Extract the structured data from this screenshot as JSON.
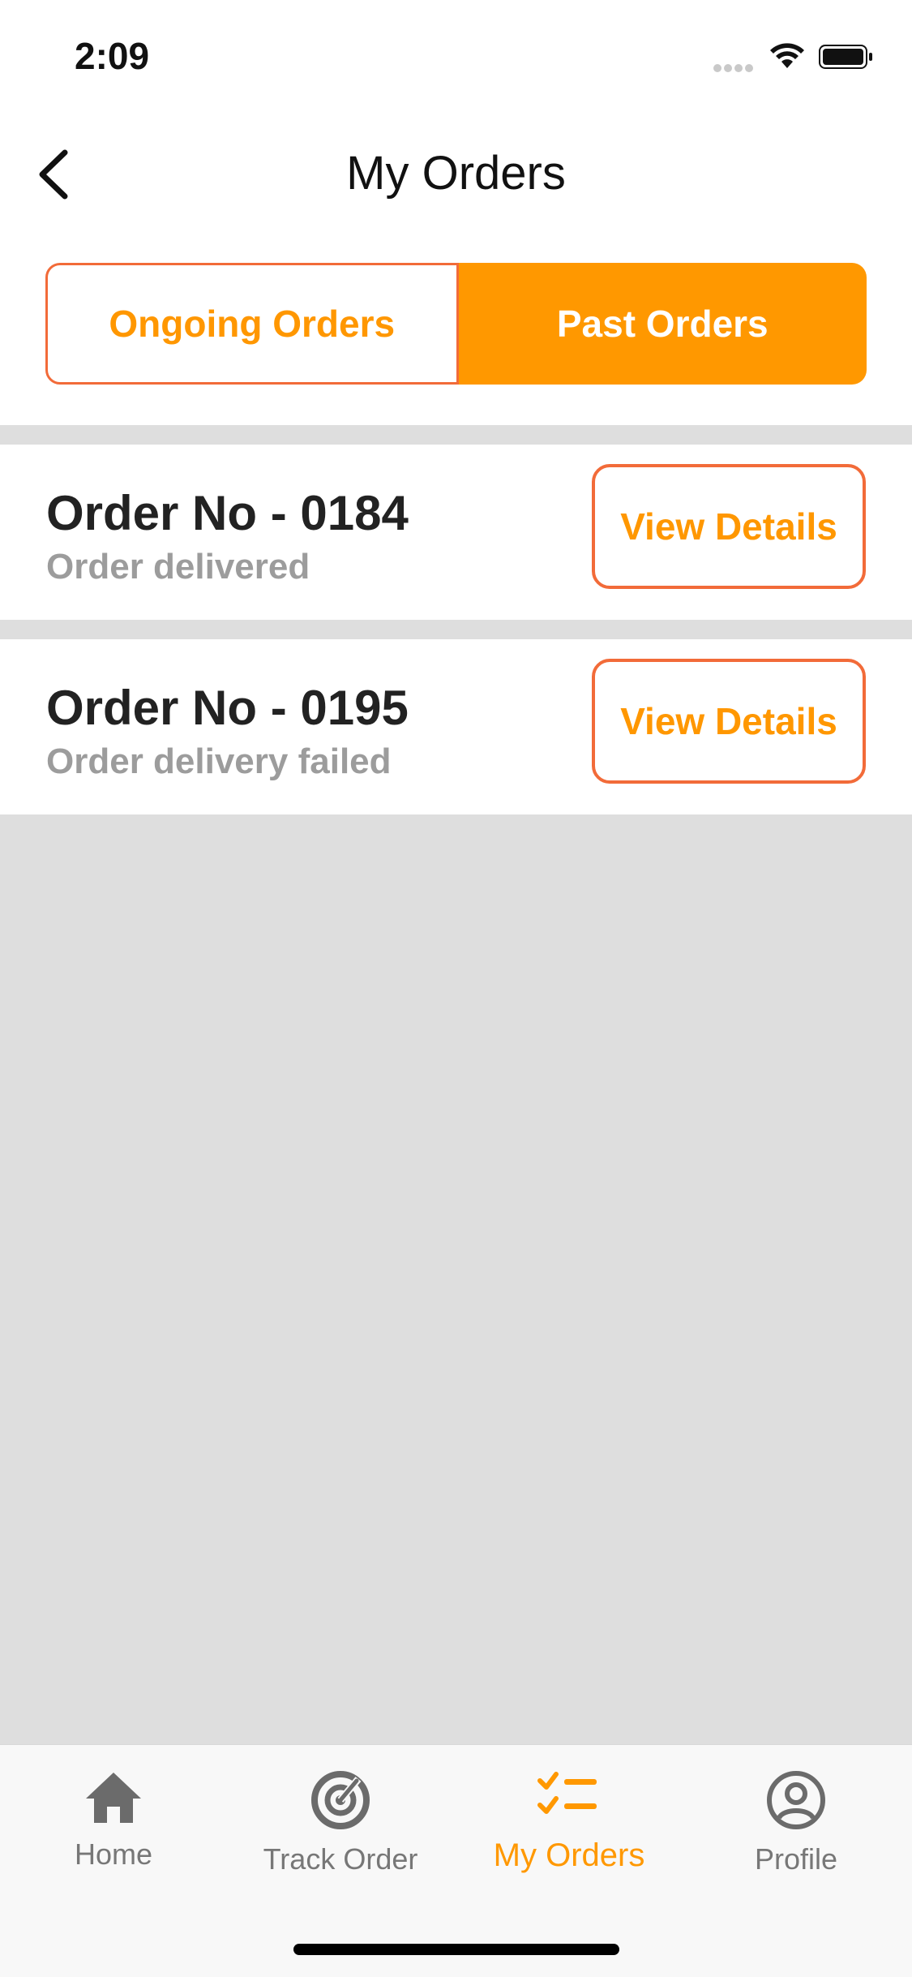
{
  "status_bar": {
    "time": "2:09"
  },
  "header": {
    "title": "My Orders"
  },
  "tabs": {
    "ongoing": "Ongoing Orders",
    "past": "Past Orders",
    "active": "past"
  },
  "orders": [
    {
      "number": "Order No - 0184",
      "status": "Order delivered",
      "action": "View Details"
    },
    {
      "number": "Order No - 0195",
      "status": "Order delivery failed",
      "action": "View Details"
    }
  ],
  "tabbar": {
    "items": [
      {
        "label": "Home",
        "icon": "home-icon"
      },
      {
        "label": "Track Order",
        "icon": "radar-icon"
      },
      {
        "label": "My Orders",
        "icon": "checklist-icon"
      },
      {
        "label": "Profile",
        "icon": "profile-icon"
      }
    ],
    "active": "My Orders"
  },
  "colors": {
    "accent": "#ff9800",
    "border": "#f26b39",
    "muted": "#9c9c9c",
    "background": "#dedede"
  }
}
